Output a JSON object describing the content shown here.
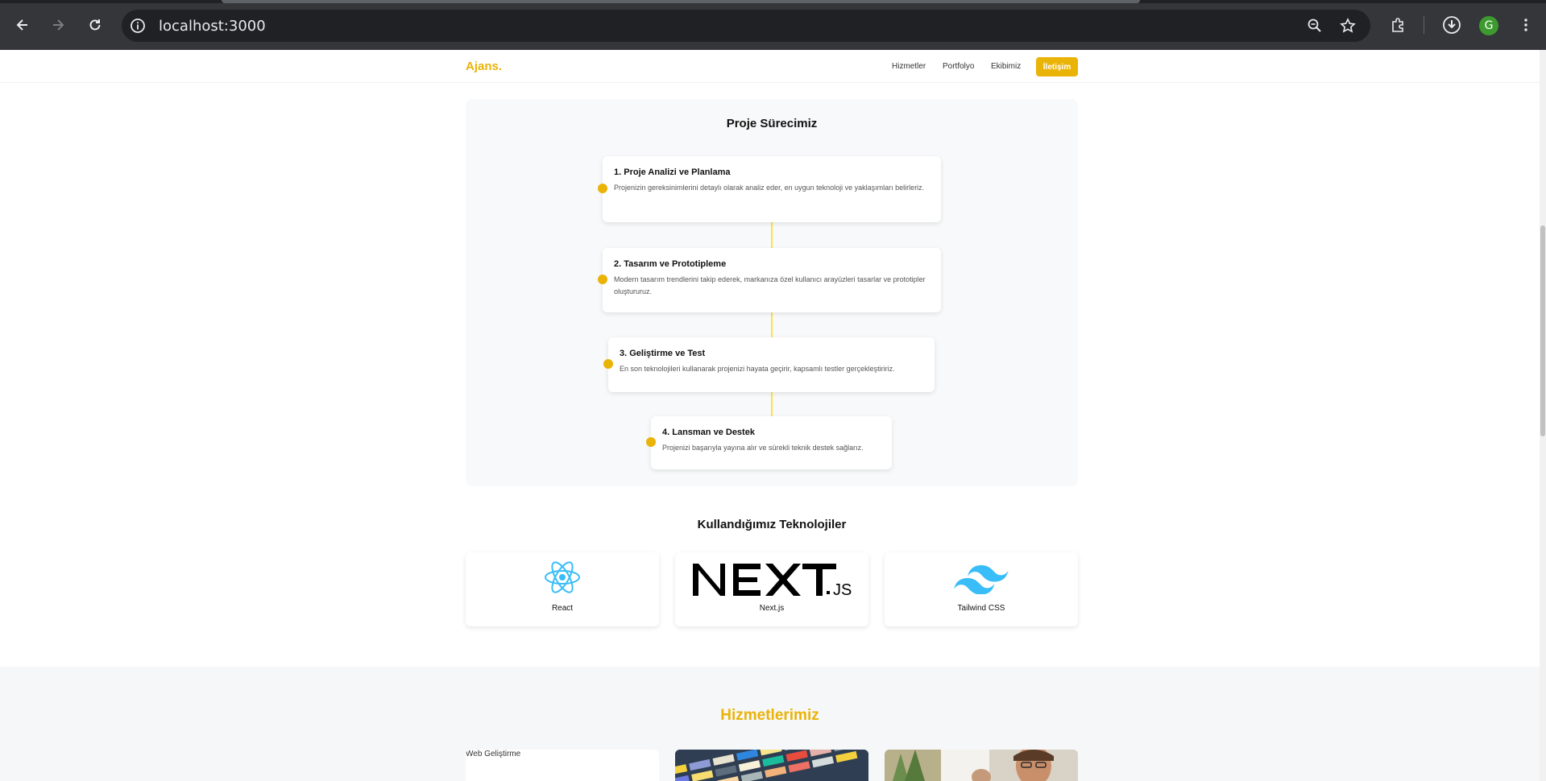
{
  "browser": {
    "url": "localhost:3000",
    "avatar_letter": "G"
  },
  "site": {
    "logo": "Ajans.",
    "nav": [
      "Hizmetler",
      "Portfolyo",
      "Ekibimiz"
    ],
    "cta": "İletişim"
  },
  "process": {
    "title": "Proje Sürecimiz",
    "steps": [
      {
        "title": "1. Proje Analizi ve Planlama",
        "desc": "Projenizin gereksinimlerini detaylı olarak analiz eder, en uygun teknoloji ve yaklaşımları belirleriz."
      },
      {
        "title": "2. Tasarım ve Prototipleme",
        "desc": "Modern tasarım trendlerini takip ederek, markanıza özel kullanıcı arayüzleri tasarlar ve prototipler oluştururuz."
      },
      {
        "title": "3. Geliştirme ve Test",
        "desc": "En son teknolojileri kullanarak projenizi hayata geçirir, kapsamlı testler gerçekleştiririz."
      },
      {
        "title": "4. Lansman ve Destek",
        "desc": "Projenizi başarıyla yayına alır ve sürekli teknik destek sağlarız."
      }
    ]
  },
  "technologies": {
    "title": "Kullandığımız Teknolojiler",
    "items": [
      {
        "name": "React",
        "icon": "react-logo"
      },
      {
        "name": "Next.js",
        "icon": "nextjs-logo"
      },
      {
        "name": "Tailwind CSS",
        "icon": "tailwind-logo"
      }
    ]
  },
  "services": {
    "title": "Hizmetlerimiz",
    "cards": [
      {
        "alt": "Web Geliştirme"
      },
      {
        "image": "design-swatches-image"
      },
      {
        "image": "team-photo-image"
      }
    ]
  },
  "colors": {
    "accent": "#eab308",
    "chrome_bg": "#35363a",
    "section_bg": "#f8f9fa"
  }
}
